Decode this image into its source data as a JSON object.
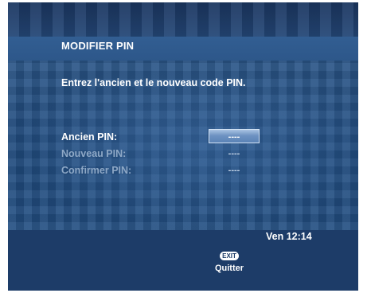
{
  "screen": {
    "title": "MODIFIER PIN",
    "instruction": "Entrez l'ancien et le nouveau code PIN."
  },
  "form": {
    "fields": [
      {
        "label": "Ancien PIN:",
        "value": "----",
        "selected": true
      },
      {
        "label": "Nouveau PIN:",
        "value": "----",
        "selected": false
      },
      {
        "label": "Confirmer PIN:",
        "value": "----",
        "selected": false
      }
    ]
  },
  "footer": {
    "clock": "Ven 12:14",
    "exit_key": "EXIT",
    "exit_label": "Quitter"
  },
  "colors": {
    "background": "#2b4f7e",
    "title_bar": "#325e92",
    "bottom_bar": "#1d3c68",
    "active_text": "#ffffff",
    "inactive_text": "#8ea8c6",
    "selected_field": "#6e93c2"
  }
}
